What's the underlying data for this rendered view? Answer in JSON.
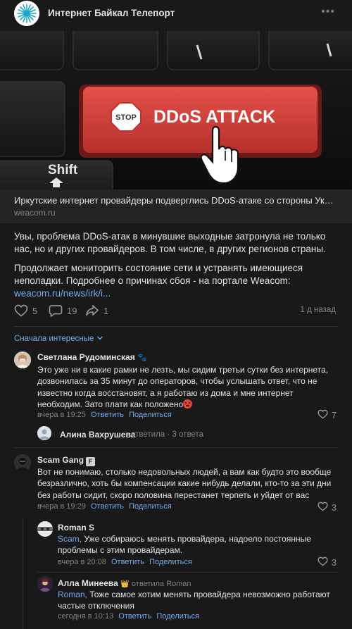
{
  "post": {
    "group_name": "Интернет Байкал Телепорт",
    "more_icon": "more-horizontal-icon",
    "link": {
      "title": "Иркутские интернет провайдеры подверглись DDoS-атаке со стороны Укра...",
      "domain": "weacom.ru",
      "image_labels": {
        "key": "DDoS ATTACK",
        "stop": "STOP",
        "shift": "Shift"
      }
    },
    "paragraph1": "Увы, проблема DDoS-атак в минувшие выходные затронула не только нас, но и других провайдеров. В том числе, в других регионов страны.",
    "paragraph2": "Продолжает мониторить состояние сети и устранять имеющиеся неполадки. Подробнее о причинах сбоя - на портале Weacom:",
    "paragraph2_link": "weacom.ru/news/irk/i...",
    "likes": "5",
    "comments": "19",
    "shares": "1",
    "time": "1 д назад"
  },
  "sort_label": "Сначала интересные",
  "comments": [
    {
      "author": "Светлана Рудоминская",
      "text": "Это уже ни в какие рамки не лезть, мы сидим третьи сутки без интернета, дозвонилась за 35 минут до операторов, чтобы услышать ответ, что не известно когда восстановят, а я работаю из дома и мне интернет необходим. Зато плати как положено",
      "time": "вчера в 19:25",
      "reply": "Ответить",
      "share": "Поделиться",
      "likes": "7"
    },
    {
      "thread_author": "Алина Вахрушева",
      "thread_verb": "ответила",
      "thread_count": "3 ответа"
    },
    {
      "author": "Scam Gang",
      "badge": "F",
      "text": "Вот не понимаю, столько недовольных людей, а вам как будто это вообще безразлично, хоть бы компенсации какие нибудь делали, кто-то за эти дни без работы сидит, скоро половина перестанет терпеть и уйдет от вас",
      "time": "вчера в 19:29",
      "reply": "Ответить",
      "share": "Поделиться",
      "likes": "3"
    },
    {
      "author": "Roman S",
      "reply_to": "Scam,",
      "text": " Уже собираюсь менять провайдера, надоело постоянные проблемы с этим провайдерам.",
      "time": "вчера в 20:08",
      "reply": "Ответить",
      "share": "Поделиться",
      "likes": "3"
    },
    {
      "author": "Алла Минеева",
      "answered": "ответила Roman",
      "reply_to": "Roman,",
      "text": " Тоже самое хотим менять провайдера невозможно работают частые отключения",
      "time": "сегодня в 10:13",
      "reply": "Ответить",
      "share": "Поделиться"
    }
  ],
  "colors": {
    "background": "#19191a",
    "accent": "#71aaeb",
    "muted": "#828282",
    "key_red": "#d33b36"
  }
}
